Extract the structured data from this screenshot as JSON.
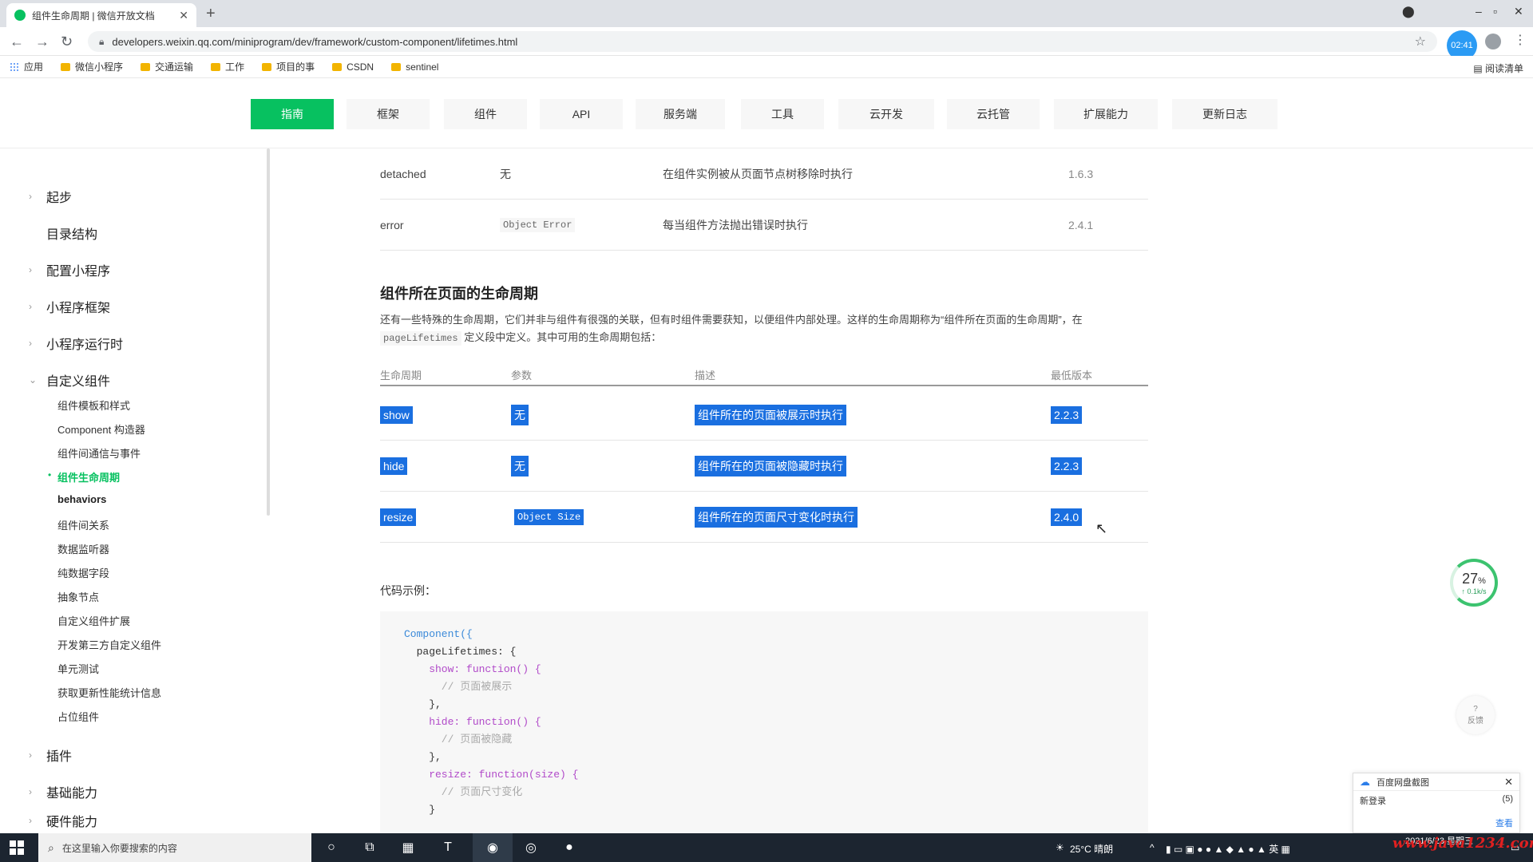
{
  "browser": {
    "tab_title": "组件生命周期 | 微信开放文档",
    "url": "developers.weixin.qq.com/miniprogram/dev/framework/custom-component/lifetimes.html",
    "timer_badge": "02:41",
    "bookmarks": [
      "应用",
      "微信小程序",
      "交通运输",
      "工作",
      "项目的事",
      "CSDN",
      "sentinel"
    ],
    "bookmarks_right": "阅读清单"
  },
  "topnav": {
    "items": [
      "指南",
      "框架",
      "组件",
      "API",
      "服务端",
      "工具",
      "云开发",
      "云托管",
      "扩展能力",
      "更新日志"
    ],
    "active": "指南"
  },
  "sidebar": {
    "groups": [
      {
        "label": "起步"
      },
      {
        "label": "目录结构"
      },
      {
        "label": "配置小程序"
      },
      {
        "label": "小程序框架"
      },
      {
        "label": "小程序运行时"
      },
      {
        "label": "自定义组件"
      }
    ],
    "sub_items": [
      {
        "label": "组件模板和样式"
      },
      {
        "label": "Component 构造器"
      },
      {
        "label": "组件间通信与事件"
      },
      {
        "label": "组件生命周期"
      },
      {
        "label": "behaviors"
      },
      {
        "label": "组件间关系"
      },
      {
        "label": "数据监听器"
      },
      {
        "label": "纯数据字段"
      },
      {
        "label": "抽象节点"
      },
      {
        "label": "自定义组件扩展"
      },
      {
        "label": "开发第三方自定义组件"
      },
      {
        "label": "单元测试"
      },
      {
        "label": "获取更新性能统计信息"
      },
      {
        "label": "占位组件"
      }
    ],
    "bottom_groups": [
      {
        "label": "插件"
      },
      {
        "label": "基础能力"
      },
      {
        "label": "硬件能力"
      }
    ]
  },
  "content": {
    "upper_rows": [
      {
        "name": "detached",
        "param": "无",
        "desc": "在组件实例被从页面节点树移除时执行",
        "version": "1.6.3"
      },
      {
        "name": "error",
        "param": "Object Error",
        "desc": "每当组件方法抛出错误时执行",
        "version": "2.4.1"
      }
    ],
    "section_title": "组件所在页面的生命周期",
    "desc_line1": "还有一些特殊的生命周期，它们并非与组件有很强的关联，但有时组件需要获知，以便组件内部处理。这样的生命周期称为“组件所在页面的生命周期”，在",
    "desc_code": "pageLifetimes",
    "desc_line2": " 定义段中定义。其中可用的生命周期包括：",
    "table_header": [
      "生命周期",
      "参数",
      "描述",
      "最低版本"
    ],
    "rows": [
      {
        "name": "show",
        "param": "无",
        "desc": "组件所在的页面被展示时执行",
        "version": "2.2.3"
      },
      {
        "name": "hide",
        "param": "无",
        "desc": "组件所在的页面被隐藏时执行",
        "version": "2.2.3"
      },
      {
        "name": "resize",
        "param": "Object Size",
        "desc": "组件所在的页面尺寸变化时执行",
        "version": "2.4.0"
      }
    ],
    "code_label": "代码示例：",
    "code_lines": {
      "l1": "Component({",
      "l2": "  pageLifetimes: {",
      "l3": "    show: function() {",
      "l4": "      // 页面被展示",
      "l5": "    },",
      "l6": "    hide: function() {",
      "l7": "      // 页面被隐藏",
      "l8": "    },",
      "l9": "    resize: function(size) {",
      "l10": "      // 页面尺寸变化",
      "l11": "    }"
    }
  },
  "floating": {
    "speed_pct": "27",
    "speed_unit": "%",
    "speed_rate": "↑ 0.1k/s",
    "feedback_label": "反馈"
  },
  "popup": {
    "title": "百度网盘截图",
    "row_label": "新登录",
    "row_value": "(5)",
    "link": "查看"
  },
  "taskbar": {
    "search_placeholder": "在这里输入你要搜索的内容",
    "weather": "25°C 晴朗",
    "time": "",
    "date": "2021/6/23 星期三"
  },
  "watermark": "www.java1234.com",
  "colors": {
    "accent": "#07c160",
    "selection": "#1a6fe0"
  }
}
